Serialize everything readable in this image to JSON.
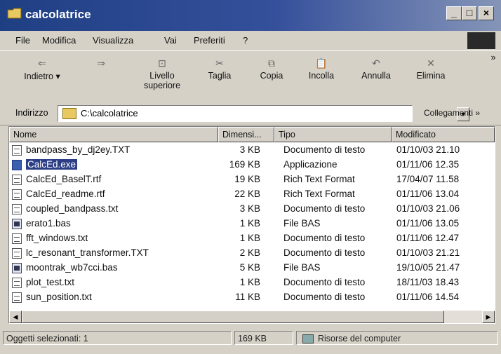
{
  "window": {
    "title": "calcolatrice",
    "buttons": [
      "_",
      "□",
      "×"
    ]
  },
  "menu": {
    "items": [
      "File",
      "Modifica",
      "Visualizza",
      "Vai",
      "Preferiti",
      "?"
    ]
  },
  "toolbar": {
    "buttons": [
      {
        "label": "Indietro",
        "glyph": "⇐"
      },
      {
        "label": "",
        "glyph": "⇒"
      },
      {
        "label": "Livello superiore",
        "glyph": "⊡"
      },
      {
        "label": "Taglia",
        "glyph": "✂"
      },
      {
        "label": "Copia",
        "glyph": "⧉"
      },
      {
        "label": "Incolla",
        "glyph": "📋"
      },
      {
        "label": "Annulla",
        "glyph": "↶"
      },
      {
        "label": "Elimina",
        "glyph": "✕"
      }
    ],
    "more": "»"
  },
  "address": {
    "label": "Indirizzo",
    "value": "C:\\calcolatrice",
    "links": "Collegamenti »"
  },
  "columns": {
    "name": "Nome",
    "size": "Dimensi...",
    "type": "Tipo",
    "modified": "Modificato"
  },
  "files": [
    {
      "name": "bandpass_by_dj2ey.TXT",
      "size": "3 KB",
      "type": "Documento di testo",
      "modified": "01/10/03 21.10",
      "icon": "text-file-icon"
    },
    {
      "name": "CalcEd.exe",
      "size": "169 KB",
      "type": "Applicazione",
      "modified": "01/11/06 12.35",
      "icon": "exe-icon",
      "selected": true
    },
    {
      "name": "CalcEd_BaselT.rtf",
      "size": "19 KB",
      "type": "Rich Text Format",
      "modified": "17/04/07 11.58",
      "icon": "rtf-icon"
    },
    {
      "name": "CalcEd_readme.rtf",
      "size": "22 KB",
      "type": "Rich Text Format",
      "modified": "01/11/06 13.04",
      "icon": "rtf-icon"
    },
    {
      "name": "coupled_bandpass.txt",
      "size": "3 KB",
      "type": "Documento di testo",
      "modified": "01/10/03 21.06",
      "icon": "text-file-icon"
    },
    {
      "name": "erato1.bas",
      "size": "1 KB",
      "type": "File BAS",
      "modified": "01/11/06 13.05",
      "icon": "bas-icon"
    },
    {
      "name": "fft_windows.txt",
      "size": "1 KB",
      "type": "Documento di testo",
      "modified": "01/11/06 12.47",
      "icon": "text-file-icon"
    },
    {
      "name": "lc_resonant_transformer.TXT",
      "size": "2 KB",
      "type": "Documento di testo",
      "modified": "01/10/03 21.21",
      "icon": "text-file-icon"
    },
    {
      "name": "moontrak_wb7cci.bas",
      "size": "5 KB",
      "type": "File BAS",
      "modified": "19/10/05 21.47",
      "icon": "bas-icon"
    },
    {
      "name": "plot_test.txt",
      "size": "1 KB",
      "type": "Documento di testo",
      "modified": "18/11/03 18.43",
      "icon": "text-file-icon"
    },
    {
      "name": "sun_position.txt",
      "size": "11 KB",
      "type": "Documento di testo",
      "modified": "01/11/06 14.54",
      "icon": "text-file-icon"
    }
  ],
  "status": {
    "selected": "Oggetti selezionati: 1",
    "size": "169 KB",
    "zone": "Risorse del computer"
  }
}
